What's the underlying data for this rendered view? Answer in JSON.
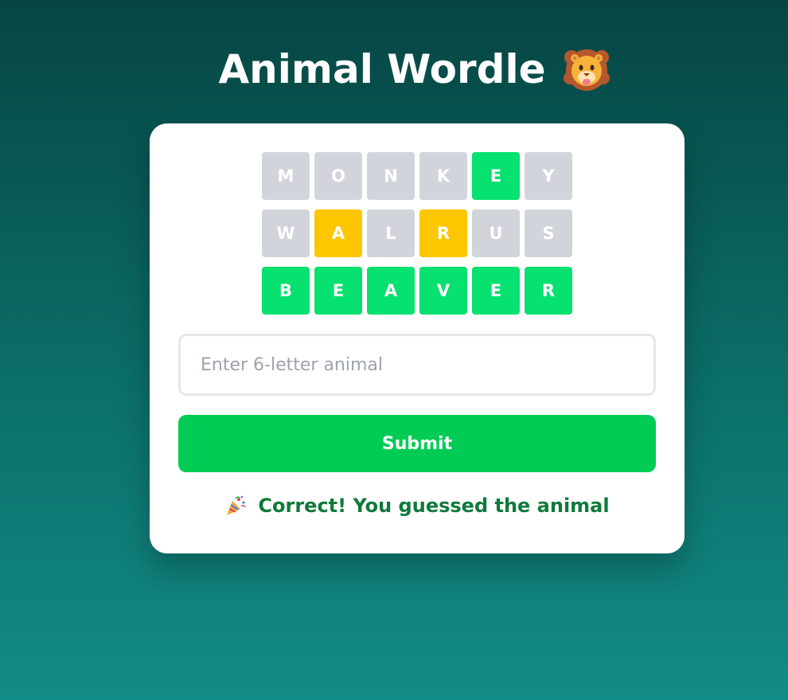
{
  "header": {
    "title": "Animal Wordle",
    "title_icon": "lion-face-icon"
  },
  "board": {
    "rows": [
      {
        "tiles": [
          {
            "letter": "M",
            "state": "absent"
          },
          {
            "letter": "O",
            "state": "absent"
          },
          {
            "letter": "N",
            "state": "absent"
          },
          {
            "letter": "K",
            "state": "absent"
          },
          {
            "letter": "E",
            "state": "correct"
          },
          {
            "letter": "Y",
            "state": "absent"
          }
        ]
      },
      {
        "tiles": [
          {
            "letter": "W",
            "state": "absent"
          },
          {
            "letter": "A",
            "state": "present"
          },
          {
            "letter": "L",
            "state": "absent"
          },
          {
            "letter": "R",
            "state": "present"
          },
          {
            "letter": "U",
            "state": "absent"
          },
          {
            "letter": "S",
            "state": "absent"
          }
        ]
      },
      {
        "tiles": [
          {
            "letter": "B",
            "state": "correct"
          },
          {
            "letter": "E",
            "state": "correct"
          },
          {
            "letter": "A",
            "state": "correct"
          },
          {
            "letter": "V",
            "state": "correct"
          },
          {
            "letter": "E",
            "state": "correct"
          },
          {
            "letter": "R",
            "state": "correct"
          }
        ]
      }
    ]
  },
  "form": {
    "input_value": "",
    "input_placeholder": "Enter 6-letter animal",
    "submit_label": "Submit"
  },
  "status": {
    "icon": "party-popper-icon",
    "message": "Correct! You guessed the animal"
  },
  "colors": {
    "correct": "#07e16f",
    "present": "#fcc600",
    "absent": "#d1d5db",
    "submit": "#00cc55",
    "status_text": "#0f7a3a"
  }
}
